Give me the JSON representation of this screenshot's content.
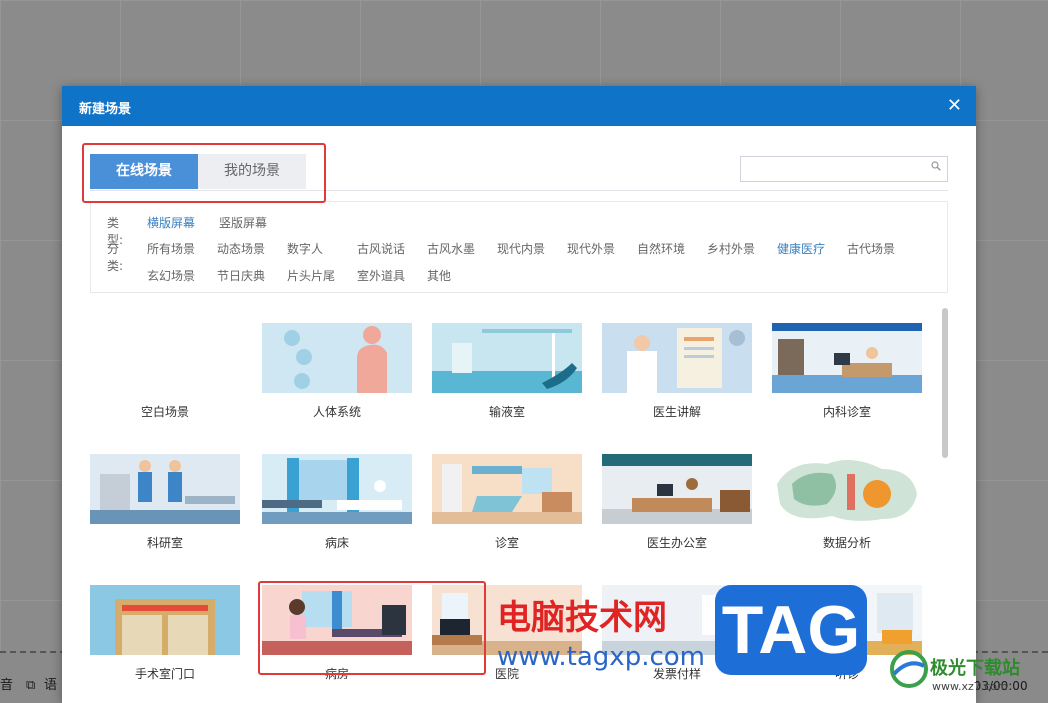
{
  "dialog": {
    "title": "新建场景",
    "close_glyph": "✕"
  },
  "tabs": [
    {
      "label": "在线场景",
      "active": true
    },
    {
      "label": "我的场景",
      "active": false
    }
  ],
  "search": {
    "placeholder": ""
  },
  "filters": {
    "type_label": "类型:",
    "type_options": [
      "横版屏幕",
      "竖版屏幕"
    ],
    "type_active": "横版屏幕",
    "category_label": "分类:",
    "category_options": [
      "所有场景",
      "动态场景",
      "数字人",
      "古风说话",
      "古风水墨",
      "现代内景",
      "现代外景",
      "自然环境",
      "乡村外景",
      "健康医疗",
      "古代场景",
      "玄幻场景",
      "节日庆典",
      "片头片尾",
      "室外道具",
      "其他"
    ],
    "category_active": "健康医疗"
  },
  "scenes": [
    {
      "label": "空白场景",
      "icon": "blank-scene"
    },
    {
      "label": "人体系统",
      "icon": "human-body-scene"
    },
    {
      "label": "输液室",
      "icon": "infusion-room-scene"
    },
    {
      "label": "医生讲解",
      "icon": "doctor-explain-scene"
    },
    {
      "label": "内科诊室",
      "icon": "internal-clinic-scene"
    },
    {
      "label": "科研室",
      "icon": "research-lab-scene"
    },
    {
      "label": "病床",
      "icon": "hospital-bed-scene"
    },
    {
      "label": "诊室",
      "icon": "clinic-room-scene"
    },
    {
      "label": "医生办公室",
      "icon": "doctor-office-scene"
    },
    {
      "label": "数据分析",
      "icon": "data-analysis-scene"
    },
    {
      "label": "手术室门口",
      "icon": "operating-room-door-scene"
    },
    {
      "label": "病房",
      "icon": "ward-scene"
    },
    {
      "label": "医院",
      "icon": "hospital-scene"
    },
    {
      "label": "发票付样",
      "icon": "invoice-scene"
    },
    {
      "label": "听诊",
      "icon": "stethoscope-scene"
    }
  ],
  "background": {
    "bottom_left_text": "音",
    "bottom_left_text2": "语",
    "timecode": "0:03/00:00"
  },
  "watermark": {
    "cn_text": "电脑技术网",
    "url": "www.tagxp.com",
    "badge": "TAG",
    "site_name": "极光下载站",
    "site_url": "www.xz7.com"
  },
  "colors": {
    "title_bar": "#0f73c8",
    "tab_active": "#4a90d9",
    "category_active": "#3b7fbf",
    "annotation_red": "#e03a3a"
  }
}
